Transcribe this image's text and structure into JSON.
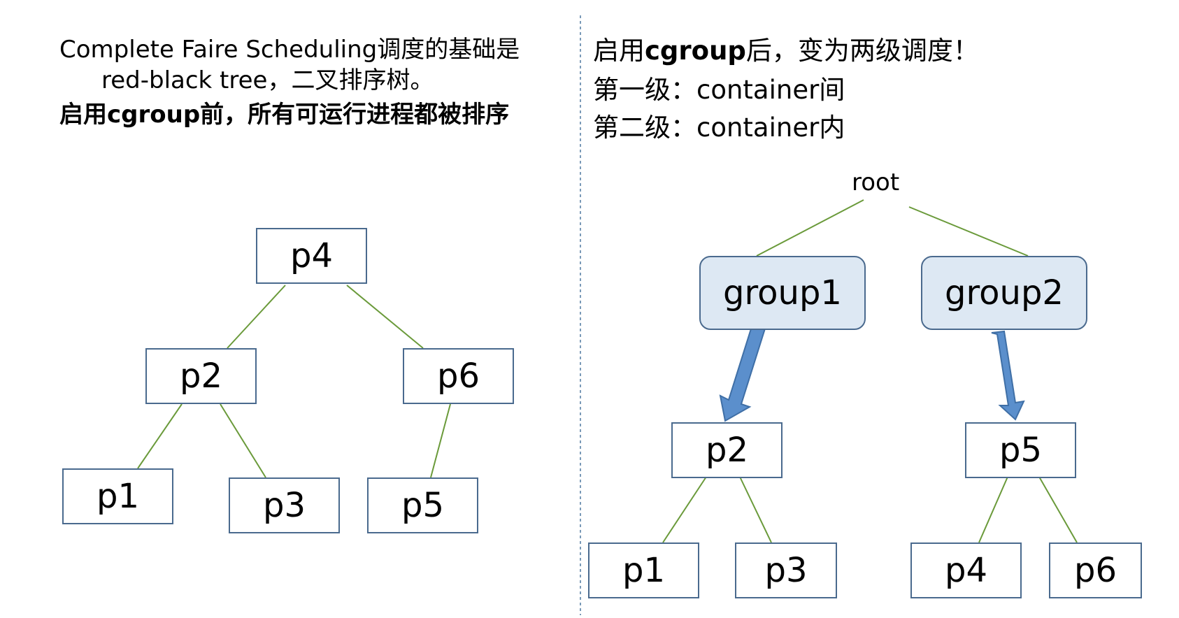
{
  "left": {
    "title_line1": "Complete Faire Scheduling调度的基础是",
    "title_line2": "red-black tree，二叉排序树。",
    "title_line3": "启用cgroup前，所有可运行进程都被排序",
    "nodes": {
      "p4": "p4",
      "p2": "p2",
      "p6": "p6",
      "p1": "p1",
      "p3": "p3",
      "p5": "p5"
    }
  },
  "right": {
    "title_prefix": "启用",
    "title_bold": "cgroup",
    "title_suffix": "后，变为两级调度！",
    "level1": "第一级：container间",
    "level2": "第二级：container内",
    "root": "root",
    "groups": {
      "group1": "group1",
      "group2": "group2"
    },
    "nodes": {
      "g1_p2": "p2",
      "g1_p1": "p1",
      "g1_p3": "p3",
      "g2_p5": "p5",
      "g2_p4": "p4",
      "g2_p6": "p6"
    }
  },
  "colors": {
    "edge": "#6a9a3a",
    "node_border": "#4a6a8e",
    "group_fill": "#dde8f3",
    "arrow_fill": "#5b8fcc",
    "divider": "#7a9ab8"
  }
}
